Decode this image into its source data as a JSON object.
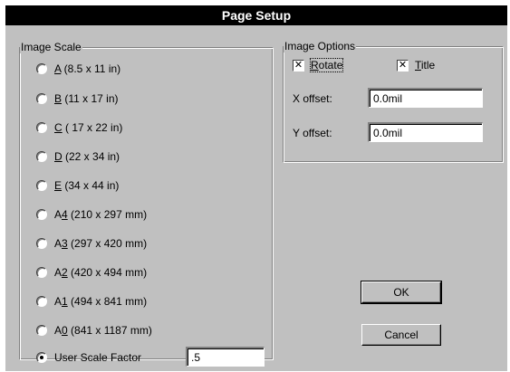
{
  "window": {
    "title": "Page Setup"
  },
  "image_scale": {
    "group_label": "Image Scale",
    "options": [
      {
        "prefix": "",
        "mnemonic": "A",
        "suffix": " (8.5 x 11 in)",
        "checked": false
      },
      {
        "prefix": "",
        "mnemonic": "B",
        "suffix": " (11 x 17 in)",
        "checked": false
      },
      {
        "prefix": "",
        "mnemonic": "C",
        "suffix": " ( 17 x 22 in)",
        "checked": false
      },
      {
        "prefix": "",
        "mnemonic": "D",
        "suffix": " (22 x 34 in)",
        "checked": false
      },
      {
        "prefix": "",
        "mnemonic": "E",
        "suffix": " (34 x 44 in)",
        "checked": false
      },
      {
        "prefix": "A",
        "mnemonic": "4",
        "suffix": " (210 x 297 mm)",
        "checked": false
      },
      {
        "prefix": "A",
        "mnemonic": "3",
        "suffix": " (297 x 420 mm)",
        "checked": false
      },
      {
        "prefix": "A",
        "mnemonic": "2",
        "suffix": " (420 x 494 mm)",
        "checked": false
      },
      {
        "prefix": "A",
        "mnemonic": "1",
        "suffix": " (494 x 841 mm)",
        "checked": false
      },
      {
        "prefix": "A",
        "mnemonic": "0",
        "suffix": " (841 x 1187 mm)",
        "checked": false
      },
      {
        "prefix": "User Scale Factor",
        "mnemonic": "",
        "suffix": "",
        "checked": true
      }
    ],
    "user_scale_value": ".5"
  },
  "image_options": {
    "group_label": "Image Options",
    "rotate": {
      "mnemonic": "R",
      "rest": "otate",
      "checked": true
    },
    "title": {
      "mnemonic": "T",
      "rest": "itle",
      "checked": true
    },
    "x_offset": {
      "label": "X offset:",
      "value": "0.0mil"
    },
    "y_offset": {
      "label": "Y offset:",
      "value": "0.0mil"
    }
  },
  "buttons": {
    "ok": "OK",
    "cancel": "Cancel"
  }
}
